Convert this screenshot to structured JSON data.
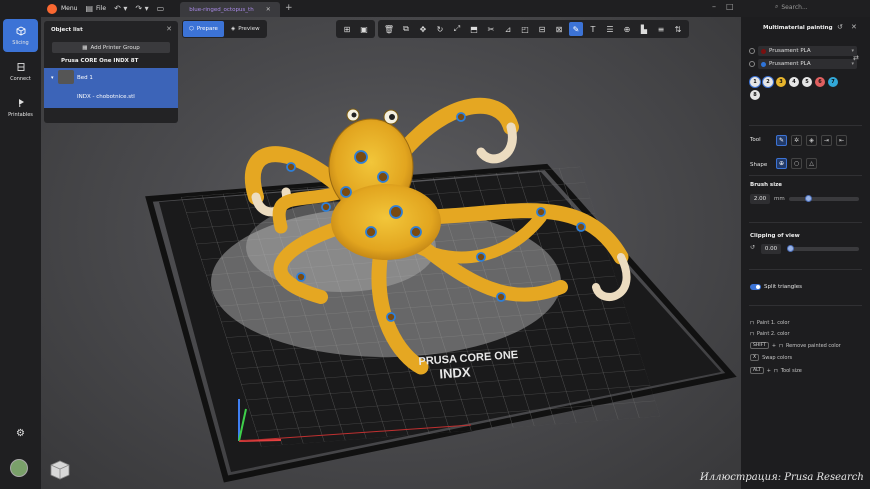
{
  "titlebar": {
    "menu_label": "Menu",
    "file_label": "File",
    "document_tab": "blue-ringed_octopus_th",
    "search_placeholder": "Search..."
  },
  "sidebar": {
    "items": [
      {
        "label": "Slicing",
        "icon": "cube-icon",
        "active": true
      },
      {
        "label": "Connect",
        "icon": "connect-icon",
        "active": false
      },
      {
        "label": "Printables",
        "icon": "printables-icon",
        "active": false
      }
    ],
    "settings_icon": "gear-icon"
  },
  "object_list": {
    "title": "Object list",
    "add_button": "Add Printer Group",
    "printer_name": "Prusa CORE One INDX 8T",
    "bed_label": "Bed 1",
    "file_label": "INDX - chobotnice.stl"
  },
  "modes": {
    "prepare": "Prepare",
    "preview": "Preview"
  },
  "bed_logo": {
    "line1": "PRUSA CORE ONE",
    "line2": "INDX"
  },
  "right_panel": {
    "title": "Multimaterial painting",
    "filaments": [
      {
        "name": "Prusament PLA",
        "color": "#7a1010"
      },
      {
        "name": "Prusament PLA",
        "color": "#2f74d8"
      }
    ],
    "extruders": [
      {
        "num": "1",
        "color": "#e6e6e6"
      },
      {
        "num": "2",
        "color": "#e6e6e6"
      },
      {
        "num": "3",
        "color": "#e8b52c"
      },
      {
        "num": "4",
        "color": "#e6e6e6"
      },
      {
        "num": "5",
        "color": "#e6e6e6"
      },
      {
        "num": "6",
        "color": "#e06060"
      },
      {
        "num": "7",
        "color": "#32a8d8"
      },
      {
        "num": "8",
        "color": "#e6e6e6"
      }
    ],
    "tool_label": "Tool",
    "shape_label": "Shape",
    "brush_size_label": "Brush size",
    "brush_size_value": "2.00",
    "brush_size_unit": "mm",
    "brush_size_level": 0.25,
    "clipping_label": "Clipping of view",
    "clipping_value": "0.00",
    "clipping_level": 0.0,
    "split_label": "Split triangles",
    "hints": {
      "paint1": "Paint 1. color",
      "paint2": "Paint 2. color",
      "shift_key": "SHIFT",
      "remove": "Remove painted color",
      "swap_key": "X",
      "swap": "Swap colors",
      "alt_key": "ALT",
      "toolsize": "Tool size",
      "plus": "+"
    }
  },
  "credit": "Иллюстрация: Prusa Research"
}
